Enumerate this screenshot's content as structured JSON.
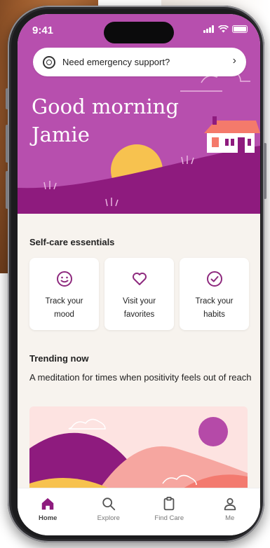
{
  "status_bar": {
    "time": "9:41"
  },
  "emergency_banner": {
    "label": "Need emergency support?"
  },
  "greeting": {
    "line1": "Good morning",
    "line2": "Jamie"
  },
  "self_care": {
    "title": "Self-care essentials",
    "cards": [
      {
        "line1": "Track your",
        "line2": "mood",
        "icon": "smile-icon"
      },
      {
        "line1": "Visit your",
        "line2": "favorites",
        "icon": "heart-icon"
      },
      {
        "line1": "Track your",
        "line2": "habits",
        "icon": "check-circle-icon"
      }
    ]
  },
  "trending": {
    "title": "Trending now",
    "description": "A meditation for times when positivity feels out of reach"
  },
  "tabbar": {
    "items": [
      {
        "label": "Home",
        "icon": "home-icon",
        "active": true
      },
      {
        "label": "Explore",
        "icon": "search-icon",
        "active": false
      },
      {
        "label": "Find Care",
        "icon": "clipboard-icon",
        "active": false
      },
      {
        "label": "Me",
        "icon": "person-icon",
        "active": false
      }
    ]
  },
  "colors": {
    "brand": "#b74fae",
    "brand_dark": "#8e1b7e",
    "sun": "#f7c24f",
    "accent_icon": "#8e2a7e"
  }
}
